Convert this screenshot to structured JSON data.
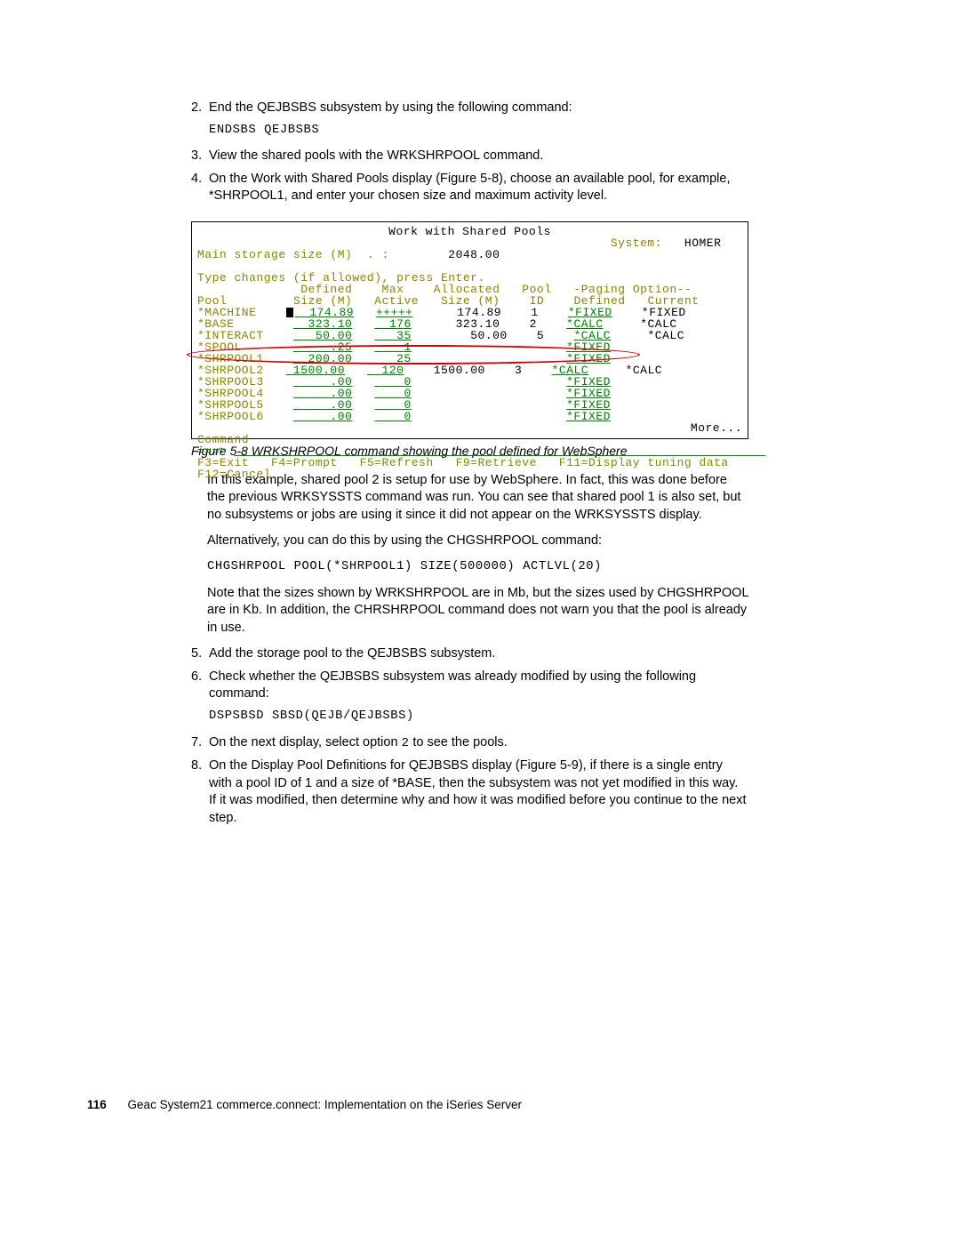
{
  "steps": {
    "s2": {
      "num": "2.",
      "text": "End the QEJBSBS subsystem by using the following command:"
    },
    "cmd2": "ENDSBS QEJBSBS",
    "s3": {
      "num": "3.",
      "text": "View the shared pools with the WRKSHRPOOL command."
    },
    "s4": {
      "num": "4.",
      "text": "On the Work with Shared Pools display (Figure 5-8), choose an available pool, for example, *SHRPOOL1, and enter your chosen size and maximum activity level."
    },
    "p5": "In this example, shared pool 2 is setup for use by WebSphere. In fact, this was done before the previous WRKSYSSTS command was run. You can see that shared pool 1 is also set, but no subsystems or jobs are using it since it did not appear on the WRKSYSSTS display.",
    "p6": "Alternatively, you can do this by using the CHGSHRPOOL command:",
    "cmd6": "CHGSHRPOOL POOL(*SHRPOOL1) SIZE(500000) ACTLVL(20)",
    "p7": "Note that the sizes shown by WRKSHRPOOL are in Mb, but the sizes used by CHGSHRPOOL are in Kb. In addition, the CHRSHRPOOL command does not warn you that the pool is already in use.",
    "s5": {
      "num": "5.",
      "text": "Add the storage pool to the QEJBSBS subsystem."
    },
    "s6": {
      "num": "6.",
      "text": "Check whether the QEJBSBS subsystem was already modified by using the following command:"
    },
    "cmd7": "DSPSBSD SBSD(QEJB/QEJBSBS)",
    "s7": {
      "num": "7.",
      "text_a": "On the next display, select option ",
      "text_code": "2",
      "text_b": " to see the pools."
    },
    "s8": {
      "num": "8.",
      "text": "On the Display Pool Definitions for QEJBSBS display (Figure 5-9), if there is a single entry with a pool ID of 1 and a size of *BASE, then the subsystem was not yet modified in this way. If it was modified, then determine why and how it was modified before you continue to the next step."
    }
  },
  "terminal": {
    "title": "Work with Shared Pools",
    "system_label": "System:",
    "system_value": "HOMER",
    "mainsize_label": "Main storage size (M)  . :",
    "mainsize_value": "2048.00",
    "help": "Type changes (if allowed), press Enter.",
    "hdr1": {
      "defined": "Defined",
      "max": "Max",
      "allocated": "Allocated",
      "pool": "Pool",
      "paging": "-Paging Option--"
    },
    "hdr2": {
      "pool": "Pool",
      "size": "Size (M)",
      "active": "Active",
      "size2": "Size (M)",
      "id": "ID",
      "defined": "Defined",
      "current": "Current"
    },
    "rows": [
      {
        "pool": "*MACHINE",
        "defined_size": "  174.89",
        "max_active": "+++++",
        "alloc": " 174.89",
        "id": "1",
        "pdef": "*FIXED",
        "pcur": "*FIXED"
      },
      {
        "pool": "*BASE",
        "defined_size": "  323.10",
        "max_active": "  176",
        "alloc": " 323.10",
        "id": "2",
        "pdef": "*CALC",
        "pcur": "*CALC"
      },
      {
        "pool": "*INTERACT",
        "defined_size": "   50.00",
        "max_active": "   35",
        "alloc": "  50.00",
        "id": "5",
        "pdef": "*CALC",
        "pcur": "*CALC"
      },
      {
        "pool": "*SPOOL",
        "defined_size": "     .25",
        "max_active": "    1",
        "alloc": "",
        "id": "",
        "pdef": "*FIXED",
        "pcur": ""
      },
      {
        "pool": "*SHRPOOL1",
        "defined_size": "  200.00",
        "max_active": "   25",
        "alloc": "",
        "id": "",
        "pdef": "*FIXED",
        "pcur": ""
      },
      {
        "pool": "*SHRPOOL2",
        "defined_size": " 1500.00",
        "max_active": "  120",
        "alloc": "1500.00",
        "id": "3",
        "pdef": "*CALC",
        "pcur": "*CALC"
      },
      {
        "pool": "*SHRPOOL3",
        "defined_size": "     .00",
        "max_active": "    0",
        "alloc": "",
        "id": "",
        "pdef": "*FIXED",
        "pcur": ""
      },
      {
        "pool": "*SHRPOOL4",
        "defined_size": "     .00",
        "max_active": "    0",
        "alloc": "",
        "id": "",
        "pdef": "*FIXED",
        "pcur": ""
      },
      {
        "pool": "*SHRPOOL5",
        "defined_size": "     .00",
        "max_active": "    0",
        "alloc": "",
        "id": "",
        "pdef": "*FIXED",
        "pcur": ""
      },
      {
        "pool": "*SHRPOOL6",
        "defined_size": "     .00",
        "max_active": "    0",
        "alloc": "",
        "id": "",
        "pdef": "*FIXED",
        "pcur": ""
      }
    ],
    "more": "More...",
    "command_label": "Command",
    "prompt": "===>",
    "fkeys": {
      "f3": "F3=Exit",
      "f4": "F4=Prompt",
      "f5": "F5=Refresh",
      "f9": "F9=Retrieve",
      "f11": "F11=Display tuning data",
      "f12": "F12=Cancel"
    }
  },
  "caption": "Figure 5-8   WRKSHRPOOL command showing the pool defined for WebSphere",
  "footer": {
    "page": "116",
    "title": "Geac System21 commerce.connect: Implementation on the iSeries Server"
  }
}
